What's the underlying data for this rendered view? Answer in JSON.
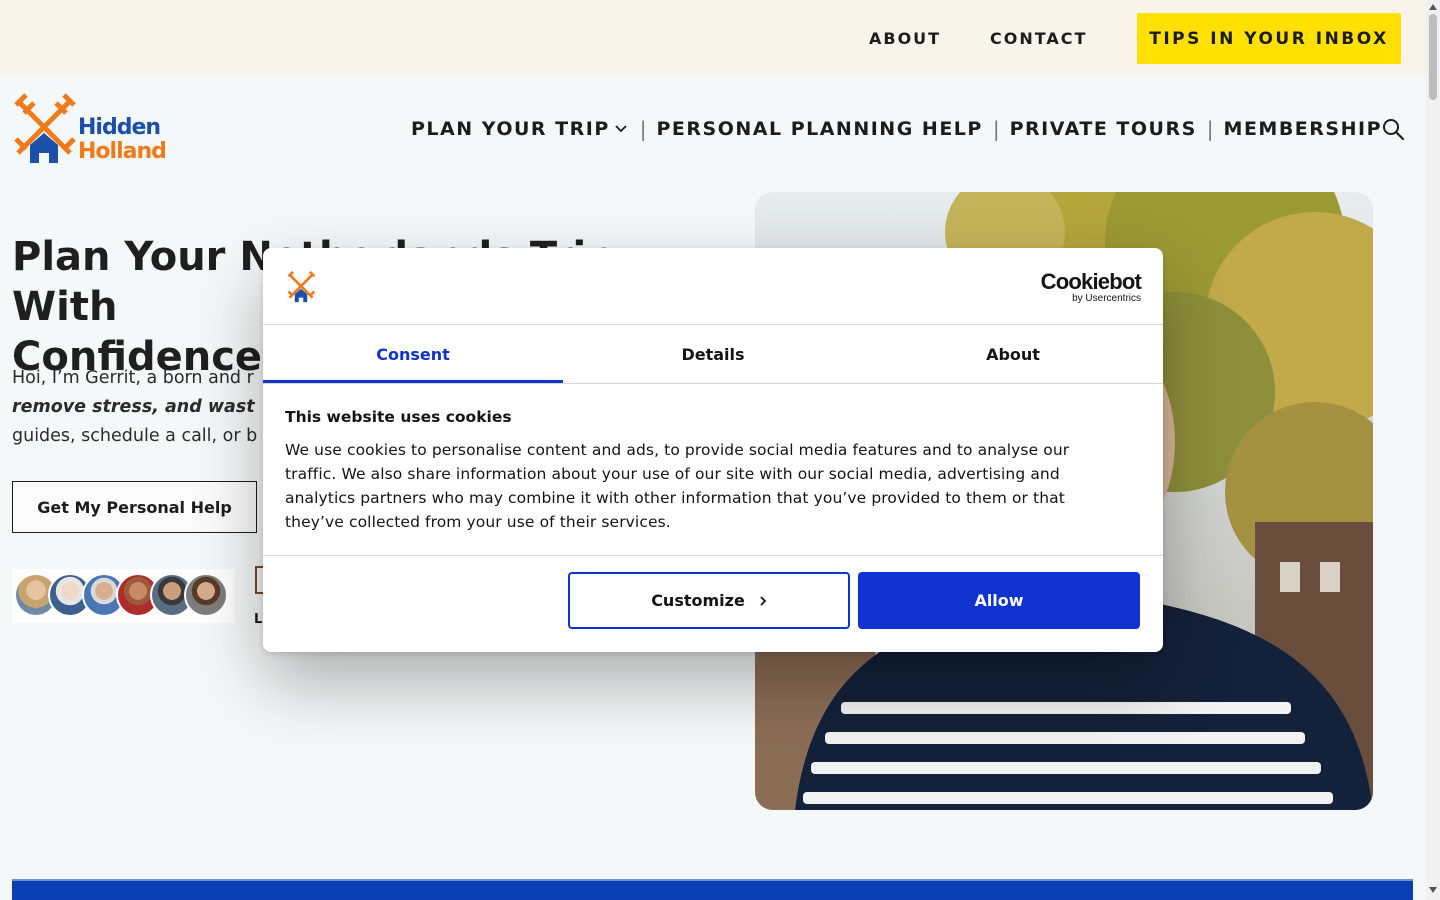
{
  "topbar": {
    "about_label": "ABOUT",
    "contact_label": "CONTACT",
    "tips_label": "TIPS IN YOUR INBOX"
  },
  "logo": {
    "line1": "Hidden",
    "line2": "Holland"
  },
  "nav": {
    "items": [
      {
        "label": "PLAN YOUR TRIP",
        "has_dropdown": true
      },
      {
        "label": "PERSONAL PLANNING HELP"
      },
      {
        "label": "PRIVATE TOURS"
      },
      {
        "label": "MEMBERSHIP"
      }
    ],
    "separator": "|",
    "search_icon": "search-icon"
  },
  "hero": {
    "title_line1": "Plan Your Netherlands Trip With",
    "title_line2": "Confidence",
    "text_line1": "Hoi, I’m Gerrit, a born and r",
    "text_line2_italic": "remove stress, and wast",
    "text_line3": "guides, schedule a call, or b",
    "cta_label": "Get My Personal Help",
    "badge_letter": "L"
  },
  "cookie_dialog": {
    "brand_name": "Cookiebot",
    "brand_sub": "by Usercentrics",
    "tabs": [
      {
        "label": "Consent",
        "active": true
      },
      {
        "label": "Details",
        "active": false
      },
      {
        "label": "About",
        "active": false
      }
    ],
    "title": "This website uses cookies",
    "body": "We use cookies to personalise content and ads, to provide social media features and to analyse our traffic. We also share information about your use of our site with our social media, advertising and analytics partners who may combine it with other information that you’ve provided to them or that they’ve collected from your use of their services.",
    "customize_label": "Customize",
    "allow_label": "Allow"
  },
  "colors": {
    "accent_blue": "#1032cf",
    "tips_yellow": "#ffe000",
    "logo_orange": "#f07a1a",
    "logo_blue": "#1b4fa8",
    "band_blue": "#0a3fb3"
  }
}
